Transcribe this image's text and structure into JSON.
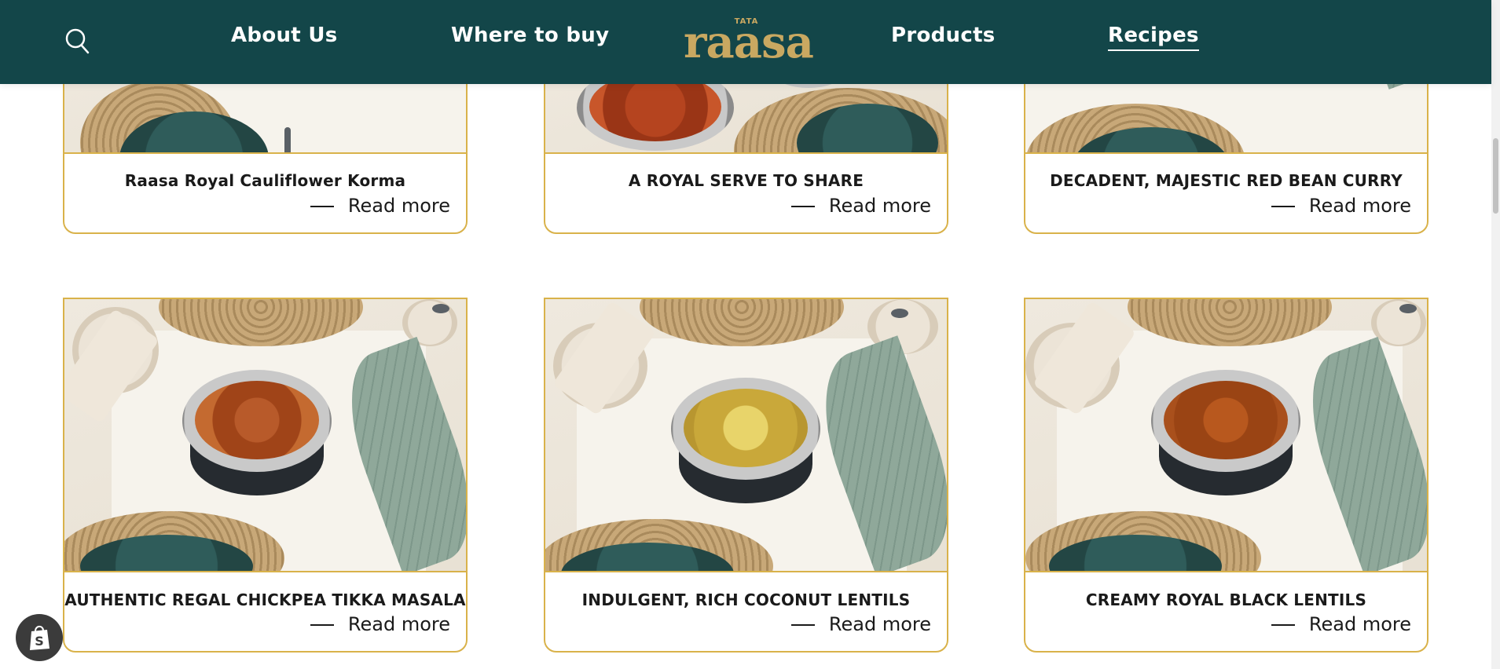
{
  "header": {
    "nav_left": [
      "About Us",
      "Where to buy"
    ],
    "logo_small": "TATA",
    "logo_word": "raasa",
    "nav_right": [
      "Products",
      "Recipes"
    ],
    "active_nav": "Recipes"
  },
  "recipes": [
    {
      "title": "Raasa Royal Cauliflower Korma",
      "read_more": "Read more",
      "dish": "korma"
    },
    {
      "title": "A ROYAL SERVE TO SHARE",
      "read_more": "Read more",
      "dish": "serve"
    },
    {
      "title": "DECADENT, MAJESTIC RED BEAN CURRY",
      "read_more": "Read more",
      "dish": "redbean"
    },
    {
      "title": "AUTHENTIC REGAL CHICKPEA TIKKA MASALA",
      "read_more": "Read more",
      "dish": "chickpea"
    },
    {
      "title": "INDULGENT, RICH COCONUT LENTILS",
      "read_more": "Read more",
      "dish": "coconut"
    },
    {
      "title": "CREAMY ROYAL BLACK LENTILS",
      "read_more": "Read more",
      "dish": "blacklentil"
    }
  ],
  "colors": {
    "header_bg": "#134649",
    "brand_gold": "#c9a861",
    "card_border": "#d9b24a"
  }
}
